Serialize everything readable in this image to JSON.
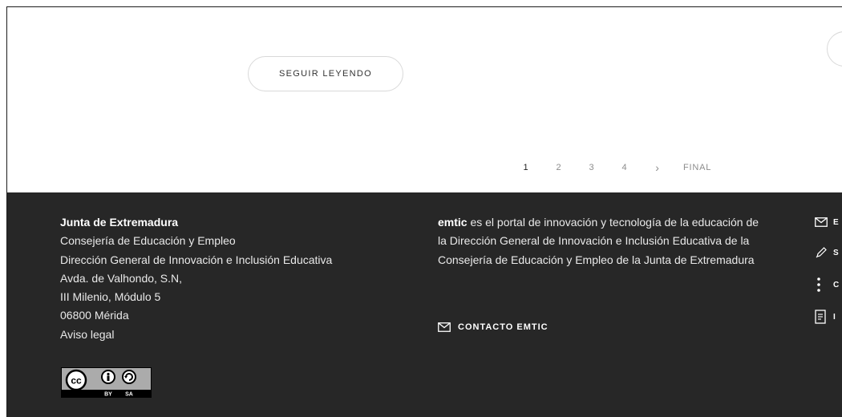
{
  "content": {
    "read_more_label": "SEGUIR LEYENDO"
  },
  "pagination": {
    "pages": [
      "1",
      "2",
      "3",
      "4"
    ],
    "current": "1",
    "next_icon": "chevron-right-icon",
    "next_glyph": "›",
    "last_label": "FINAL"
  },
  "footer": {
    "org_name": "Junta de Extremadura",
    "address_lines": [
      "Consejería de Educación y Empleo",
      "Dirección General de Innovación e Inclusión Educativa",
      "Avda. de Valhondo, S.N,",
      "III Milenio, Módulo 5",
      "06800 Mérida"
    ],
    "legal_link": "Aviso legal",
    "license_badge": {
      "icon": "creative-commons-by-sa-icon",
      "text": [
        "cc",
        "BY",
        "SA"
      ]
    },
    "about_brand": "emtic",
    "about_text": " es el portal de innovación y tecnología de la educación de la Dirección General de Innovación e Inclusión Educativa de la Consejería de Educación y Empleo de la Junta de Extremadura",
    "contact_label": "CONTACTO EMTIC",
    "contact_icon": "envelope-icon",
    "side_links": [
      {
        "icon": "envelope-icon",
        "label": "E"
      },
      {
        "icon": "pencil-icon",
        "label": "S"
      },
      {
        "icon": "more-vertical-icon",
        "label": "C"
      },
      {
        "icon": "document-icon",
        "label": "I"
      }
    ]
  },
  "colors": {
    "footer_bg": "#272727",
    "footer_text": "#e9e9e9",
    "pagination_active": "#222222",
    "pagination_inactive": "#8c8c8c",
    "button_border": "#d9d9d9"
  }
}
